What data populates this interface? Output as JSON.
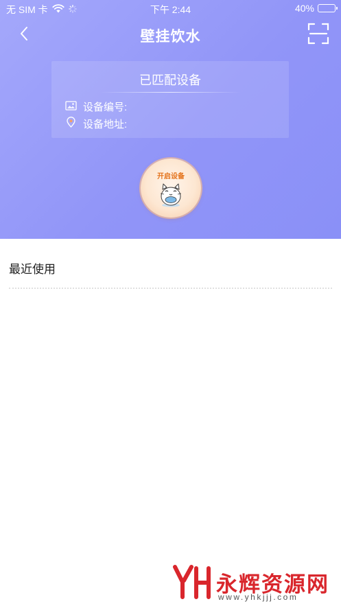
{
  "status_bar": {
    "carrier": "无 SIM 卡",
    "time": "下午 2:44",
    "battery": "40%",
    "battery_level": 0.4
  },
  "nav": {
    "title": "壁挂饮水",
    "back_icon": "chevron-left-icon",
    "scan_icon": "scan-icon"
  },
  "device_card": {
    "title": "已匹配设备",
    "number_label": "设备编号:",
    "address_label": "设备地址:"
  },
  "power_button": {
    "label": "开启设备"
  },
  "recent": {
    "title": "最近使用"
  },
  "watermark": {
    "logo_text": "YH",
    "text": "永辉资源网",
    "url": "www.yhkjjj.com"
  },
  "colors": {
    "hero_start": "#a4a8fb",
    "hero_end": "#8a90f7",
    "power_label": "#e4721a",
    "watermark_red": "#d9262c"
  }
}
